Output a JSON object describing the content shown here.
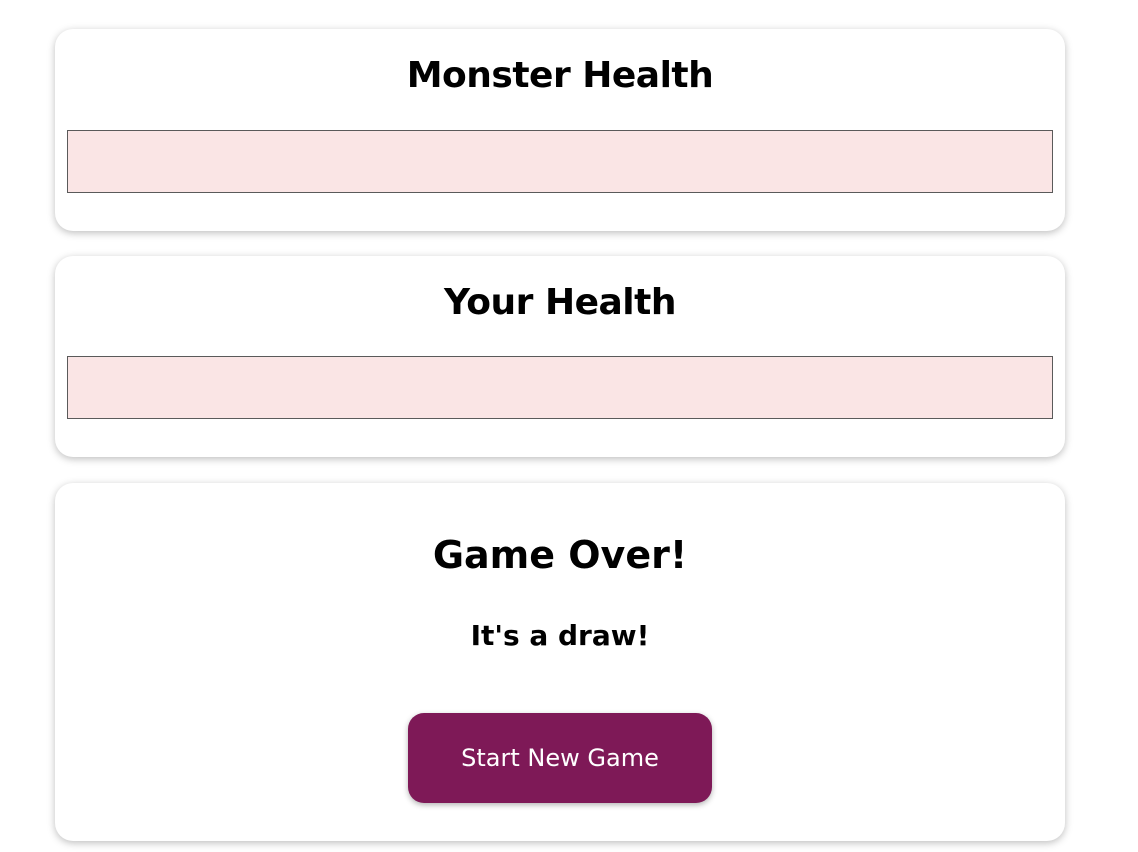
{
  "monster": {
    "title": "Monster Health",
    "health_percent": 0
  },
  "player": {
    "title": "Your Health",
    "health_percent": 0
  },
  "game_over": {
    "title": "Game Over!",
    "message": "It's a draw!",
    "new_game_label": "Start New Game"
  },
  "colors": {
    "healthbar_background": "#fae5e5",
    "healthbar_fill": "#00a876",
    "button_accent": "#7e1957"
  }
}
